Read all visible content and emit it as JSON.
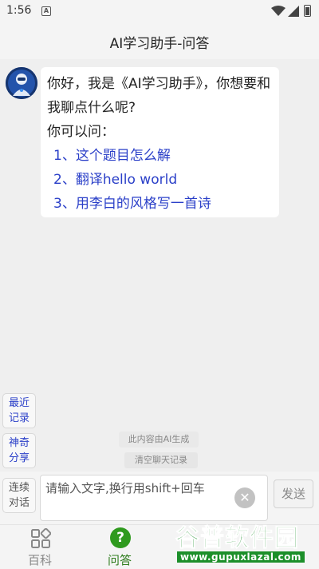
{
  "status_bar": {
    "time": "1:56",
    "notification_badge": "A"
  },
  "header": {
    "title": "AI学习助手-问答"
  },
  "chat": {
    "bot_message": {
      "greeting": "你好，我是《AI学习助手》，你想要和我聊点什么呢?",
      "prompt": "你可以问：",
      "suggestions": [
        "1、这个题目怎么解",
        "2、翻译hello world",
        "3、用李白的风格写一首诗"
      ]
    }
  },
  "side_actions": {
    "recent_records": "最近\n记录",
    "magic_share": "神奇\n分享"
  },
  "notices": {
    "ai_generated": "此内容由AI生成",
    "clear_history": "清空聊天记录"
  },
  "input_bar": {
    "continuous_dialog": "连续\n对话",
    "placeholder": "请输入文字,换行用shift+回车",
    "send_label": "发送",
    "clear_icon": "close-circle"
  },
  "tabs": [
    {
      "label": "百科",
      "icon": "grid-icon",
      "active": false
    },
    {
      "label": "问答",
      "icon": "question-icon",
      "active": true
    }
  ],
  "watermark": {
    "name": "谷普软件园",
    "url": "www.gupuxlazal.com"
  },
  "colors": {
    "accent_blue": "#2a3fc8",
    "active_tab_green": "#2f7d1e",
    "background": "#efefef",
    "watermark_green": "#1c8f2a"
  }
}
